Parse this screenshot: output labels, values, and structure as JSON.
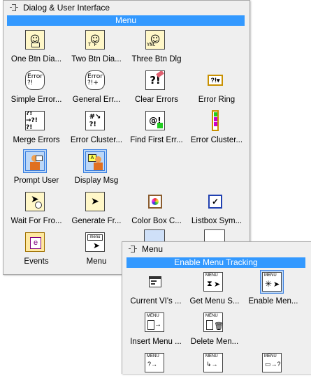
{
  "palette1": {
    "title": "Dialog & User Interface",
    "bar": "Menu",
    "items": [
      {
        "label": "One Btn Dia...",
        "icon": "one-button-dialog-icon"
      },
      {
        "label": "Two Btn Dia...",
        "icon": "two-button-dialog-icon"
      },
      {
        "label": "Three Btn Dlg",
        "icon": "three-button-dialog-icon"
      },
      {
        "label": "Simple Error...",
        "icon": "simple-error-handler-icon"
      },
      {
        "label": "General Err...",
        "icon": "general-error-handler-icon"
      },
      {
        "label": "Clear Errors",
        "icon": "clear-errors-icon"
      },
      {
        "label": "Error Ring",
        "icon": "error-ring-icon"
      },
      {
        "label": "Merge Errors",
        "icon": "merge-errors-icon"
      },
      {
        "label": "Error Cluster...",
        "icon": "error-cluster-from-code-icon"
      },
      {
        "label": "Find First Err...",
        "icon": "find-first-error-icon"
      },
      {
        "label": "Error Cluster...",
        "icon": "error-cluster-constant-icon"
      },
      {
        "label": "Prompt User",
        "icon": "prompt-user-icon"
      },
      {
        "label": "Display Msg",
        "icon": "display-message-icon"
      },
      {
        "label": "Wait For Fro...",
        "icon": "wait-for-front-panel-icon"
      },
      {
        "label": "Generate Fr...",
        "icon": "generate-front-panel-activity-icon"
      },
      {
        "label": "Color Box C...",
        "icon": "color-box-constant-icon"
      },
      {
        "label": "Listbox Sym...",
        "icon": "listbox-symbol-ring-icon"
      },
      {
        "label": "Events",
        "icon": "events-icon"
      },
      {
        "label": "Menu",
        "icon": "menu-icon"
      }
    ]
  },
  "palette2": {
    "title": "Menu",
    "bar": "Enable Menu Tracking",
    "items": [
      {
        "label": "Current VI's ...",
        "icon": "current-vi-menubar-icon"
      },
      {
        "label": "Get Menu S...",
        "icon": "get-menu-selection-icon"
      },
      {
        "label": "Enable Men...",
        "icon": "enable-menu-tracking-icon"
      },
      {
        "label": "Insert Menu ...",
        "icon": "insert-menu-items-icon"
      },
      {
        "label": "Delete Men...",
        "icon": "delete-menu-items-icon"
      },
      {
        "label": "",
        "icon": "get-menu-item-info-icon"
      },
      {
        "label": "",
        "icon": "set-menu-item-info-icon"
      },
      {
        "label": "",
        "icon": "get-menu-shortcut-info-icon"
      }
    ]
  }
}
